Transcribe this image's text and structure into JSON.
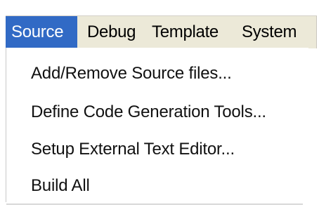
{
  "menubar": {
    "items": [
      {
        "label": "Source",
        "active": true
      },
      {
        "label": "Debug",
        "active": false
      },
      {
        "label": "Template",
        "active": false
      },
      {
        "label": "System",
        "active": false
      }
    ]
  },
  "dropdown": {
    "items": [
      {
        "label": "Add/Remove Source files..."
      },
      {
        "label": "Define Code Generation Tools..."
      },
      {
        "label": "Setup External Text Editor..."
      },
      {
        "label": "Build All"
      }
    ]
  },
  "colors": {
    "active_highlight": "#316ac5",
    "menubar_background": "#ece9d8",
    "dropdown_background": "#ffffff"
  }
}
